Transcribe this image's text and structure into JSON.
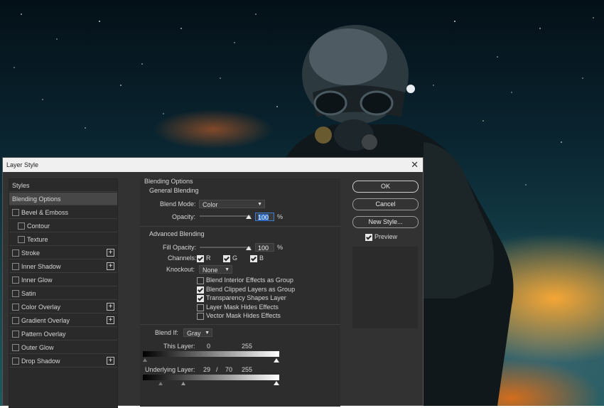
{
  "dialog": {
    "title": "Layer Style",
    "close_glyph": "✕"
  },
  "styles_panel": {
    "header": "Styles",
    "items": [
      {
        "label": "Blending Options",
        "selected": true,
        "checkbox": false,
        "plus": false
      },
      {
        "label": "Bevel & Emboss",
        "checkbox": true,
        "checked": false,
        "plus": false
      },
      {
        "label": "Contour",
        "checkbox": true,
        "checked": false,
        "indent": true
      },
      {
        "label": "Texture",
        "checkbox": true,
        "checked": false,
        "indent": true
      },
      {
        "label": "Stroke",
        "checkbox": true,
        "checked": false,
        "plus": true
      },
      {
        "label": "Inner Shadow",
        "checkbox": true,
        "checked": false,
        "plus": true
      },
      {
        "label": "Inner Glow",
        "checkbox": true,
        "checked": false,
        "plus": false
      },
      {
        "label": "Satin",
        "checkbox": true,
        "checked": false,
        "plus": false
      },
      {
        "label": "Color Overlay",
        "checkbox": true,
        "checked": false,
        "plus": true
      },
      {
        "label": "Gradient Overlay",
        "checkbox": true,
        "checked": false,
        "plus": true
      },
      {
        "label": "Pattern Overlay",
        "checkbox": true,
        "checked": false,
        "plus": false
      },
      {
        "label": "Outer Glow",
        "checkbox": true,
        "checked": false,
        "plus": false
      },
      {
        "label": "Drop Shadow",
        "checkbox": true,
        "checked": false,
        "plus": true
      }
    ],
    "plus_glyph": "+"
  },
  "blending": {
    "section_title": "Blending Options",
    "general": {
      "title": "General Blending",
      "blend_mode_label": "Blend Mode:",
      "blend_mode_value": "Color",
      "opacity_label": "Opacity:",
      "opacity_value": "100",
      "opacity_unit": "%",
      "opacity_level": 1.0
    },
    "advanced": {
      "title": "Advanced Blending",
      "fill_opacity_label": "Fill Opacity:",
      "fill_opacity_value": "100",
      "fill_opacity_unit": "%",
      "fill_opacity_level": 1.0,
      "channels_label": "Channels:",
      "channel_r": "R",
      "channel_g": "G",
      "channel_b": "B",
      "knockout_label": "Knockout:",
      "knockout_value": "None",
      "options": [
        {
          "label": "Blend Interior Effects as Group",
          "checked": false
        },
        {
          "label": "Blend Clipped Layers as Group",
          "checked": true
        },
        {
          "label": "Transparency Shapes Layer",
          "checked": true
        },
        {
          "label": "Layer Mask Hides Effects",
          "checked": false
        },
        {
          "label": "Vector Mask Hides Effects",
          "checked": false
        }
      ]
    },
    "blend_if": {
      "label": "Blend If:",
      "value": "Gray",
      "this_layer_label": "This Layer:",
      "this_layer_low": "0",
      "this_layer_high": "255",
      "underlying_label": "Underlying Layer:",
      "underlying_low_a": "29",
      "underlying_sep": "/",
      "underlying_low_b": "70",
      "underlying_high": "255"
    }
  },
  "buttons": {
    "ok": "OK",
    "cancel": "Cancel",
    "new_style": "New Style...",
    "preview_label": "Preview"
  }
}
